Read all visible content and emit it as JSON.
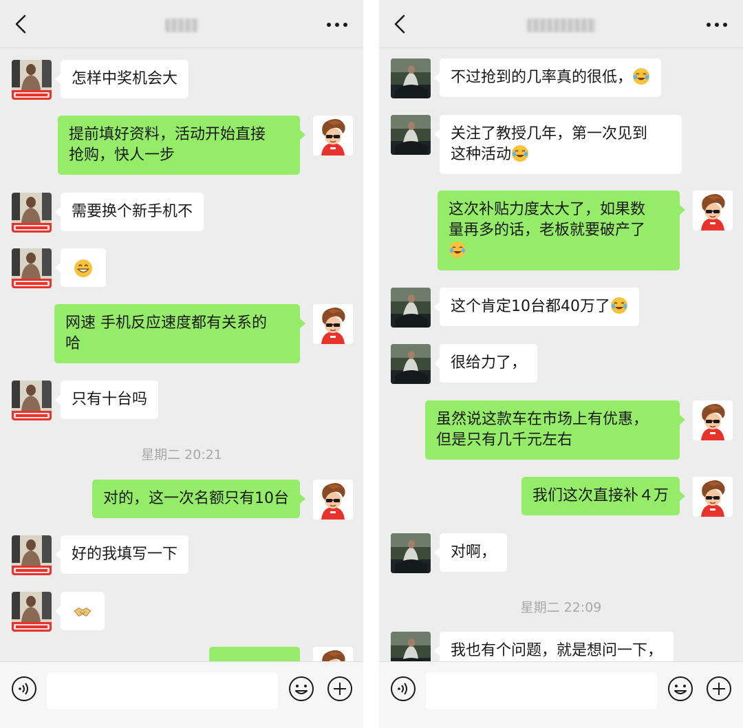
{
  "colors": {
    "chat_background": "#ededed",
    "incoming_bubble": "#ffffff",
    "outgoing_bubble": "#95ec69",
    "timestamp": "#a8a8a8"
  },
  "icons": {
    "back": "chevron-left-icon",
    "more": "more-dots-icon",
    "voice": "voice-icon",
    "emoji": "emoji-smile-icon",
    "plus": "plus-icon"
  },
  "left": {
    "timestamp": "星期二 20:21",
    "messages": [
      {
        "side": "in",
        "text": "怎样中奖机会大"
      },
      {
        "side": "out",
        "line1": "提前填好资料，活动开始直接",
        "line2": "抢购，快人一步"
      },
      {
        "side": "in",
        "text": "需要换个新手机不"
      },
      {
        "side": "in",
        "emoji": "grin-emoji"
      },
      {
        "side": "out",
        "line1": "网速 手机反应速度都有关系的",
        "line2": "哈"
      },
      {
        "side": "in",
        "text": "只有十台吗"
      },
      {
        "side": "out",
        "text": "对的，这一次名额只有10台"
      },
      {
        "side": "in",
        "text": "好的我填写一下"
      },
      {
        "side": "in",
        "emoji": "handshake-emoji"
      }
    ]
  },
  "right": {
    "timestamp": "星期二 22:09",
    "messages": [
      {
        "side": "in",
        "text": "不过抢到的几率真的很低，",
        "emoji": "laugh-cry-emoji"
      },
      {
        "side": "in",
        "line1": "关注了教授几年，第一次见到",
        "line2": "这种活动",
        "emoji": "laugh-cry-emoji"
      },
      {
        "side": "out",
        "line1": "这次补贴力度太大了，如果数",
        "line2": "量再多的话，老板就要破产了",
        "emoji": "laugh-cry-emoji"
      },
      {
        "side": "in",
        "text": "这个肯定10台都40万了",
        "emoji": "laugh-cry-emoji"
      },
      {
        "side": "in",
        "text": "很给力了，"
      },
      {
        "side": "out",
        "line1": "虽然说这款车在市场上有优惠，",
        "line2": "但是只有几千元左右"
      },
      {
        "side": "out",
        "text": "我们这次直接补４万"
      },
      {
        "side": "in",
        "text": "对啊，"
      },
      {
        "side": "in",
        "text": "我也有个问题，就是想问一下，"
      }
    ]
  }
}
